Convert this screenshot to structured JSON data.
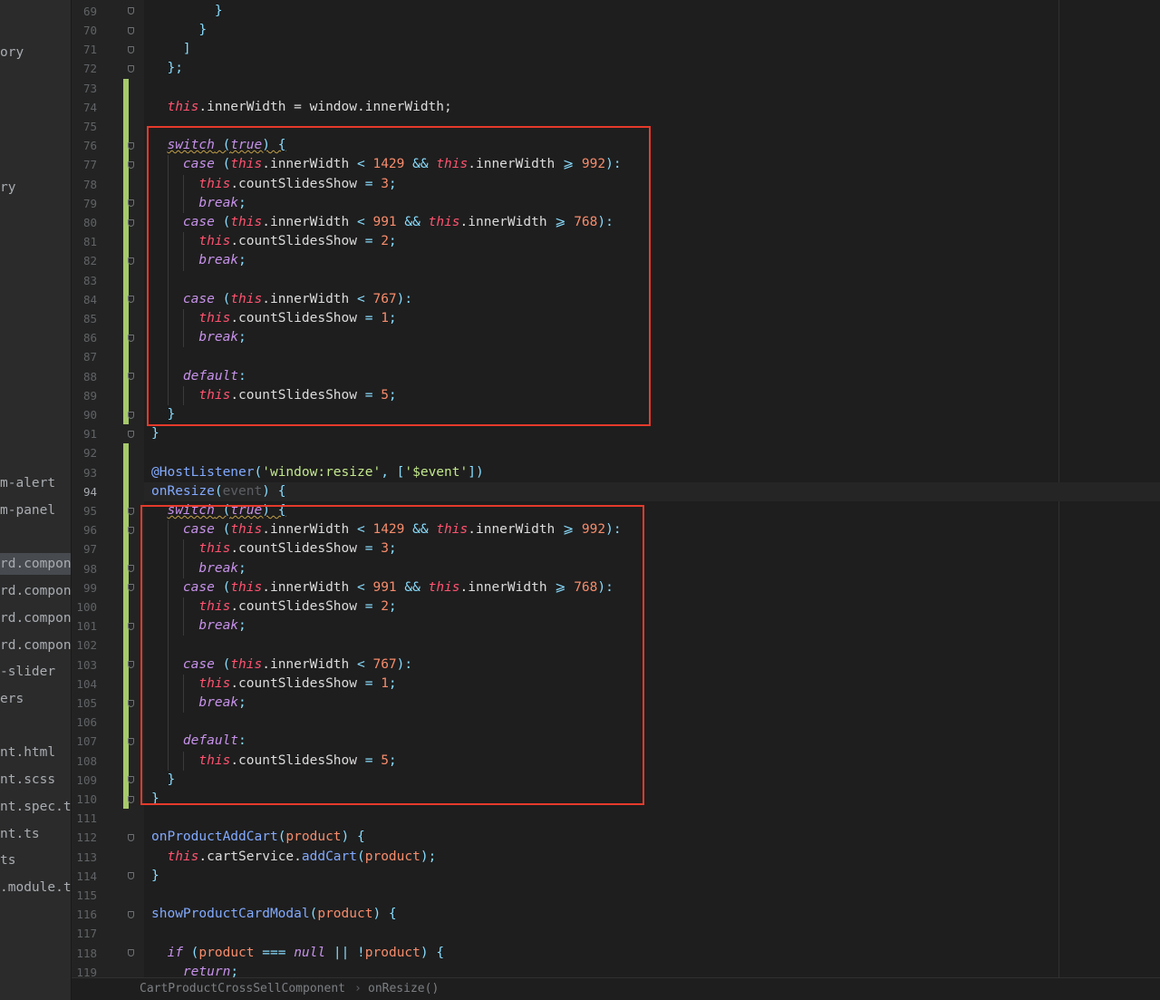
{
  "sidebar": {
    "items": [
      {
        "label": "ory",
        "selected": false
      },
      {
        "label": "ry",
        "selected": false
      },
      {
        "label": "m-alert",
        "selected": false
      },
      {
        "label": "m-panel",
        "selected": false
      },
      {
        "label": "rd.compone",
        "selected": true
      },
      {
        "label": "rd.compone",
        "selected": false
      },
      {
        "label": "rd.compone",
        "selected": false
      },
      {
        "label": "rd.compone",
        "selected": false
      },
      {
        "label": "-slider",
        "selected": false
      },
      {
        "label": "ers",
        "selected": false
      },
      {
        "label": "nt.html",
        "selected": false
      },
      {
        "label": "nt.scss",
        "selected": false
      },
      {
        "label": "nt.spec.t",
        "selected": false
      },
      {
        "label": "nt.ts",
        "selected": false
      },
      {
        "label": "ts",
        "selected": false
      },
      {
        "label": ".module.t",
        "selected": false
      }
    ]
  },
  "editor": {
    "current_line": 94,
    "lines": [
      {
        "n": 69,
        "code": [
          [
            "        }",
            "op"
          ]
        ]
      },
      {
        "n": 70,
        "code": [
          [
            "      }",
            "op"
          ]
        ]
      },
      {
        "n": 71,
        "code": [
          [
            "    ]",
            "op"
          ]
        ]
      },
      {
        "n": 72,
        "code": [
          [
            "  };",
            "op"
          ]
        ]
      },
      {
        "n": 73,
        "code": []
      },
      {
        "n": 74,
        "code": [
          [
            "  ",
            "id"
          ],
          [
            "this",
            "th"
          ],
          [
            ".innerWidth = window.innerWidth;",
            "id"
          ]
        ]
      },
      {
        "n": 75,
        "code": []
      },
      {
        "n": 76,
        "code": [
          [
            "  ",
            "id"
          ],
          [
            "switch",
            "kw wavy"
          ],
          [
            " (",
            "op wavy"
          ],
          [
            "true",
            "kw wavy"
          ],
          [
            ") {",
            "op wavy"
          ]
        ]
      },
      {
        "n": 77,
        "code": [
          [
            "    ",
            "id"
          ],
          [
            "case",
            "kw"
          ],
          [
            " (",
            "op"
          ],
          [
            "this",
            "th"
          ],
          [
            ".innerWidth ",
            "id"
          ],
          [
            "<",
            "op"
          ],
          [
            " ",
            "id"
          ],
          [
            "1429",
            "num"
          ],
          [
            " ",
            "id"
          ],
          [
            "&&",
            "op"
          ],
          [
            " ",
            "id"
          ],
          [
            "this",
            "th"
          ],
          [
            ".innerWidth ",
            "id"
          ],
          [
            "⩾",
            "op"
          ],
          [
            " ",
            "id"
          ],
          [
            "992",
            "num"
          ],
          [
            "):",
            "op"
          ]
        ]
      },
      {
        "n": 78,
        "code": [
          [
            "      ",
            "id"
          ],
          [
            "this",
            "th"
          ],
          [
            ".countSlidesShow ",
            "id"
          ],
          [
            "=",
            "op"
          ],
          [
            " ",
            "id"
          ],
          [
            "3",
            "num"
          ],
          [
            ";",
            "op"
          ]
        ]
      },
      {
        "n": 79,
        "code": [
          [
            "      ",
            "id"
          ],
          [
            "break",
            "kw"
          ],
          [
            ";",
            "op"
          ]
        ]
      },
      {
        "n": 80,
        "code": [
          [
            "    ",
            "id"
          ],
          [
            "case",
            "kw"
          ],
          [
            " (",
            "op"
          ],
          [
            "this",
            "th"
          ],
          [
            ".innerWidth ",
            "id"
          ],
          [
            "<",
            "op"
          ],
          [
            " ",
            "id"
          ],
          [
            "991",
            "num"
          ],
          [
            " ",
            "id"
          ],
          [
            "&&",
            "op"
          ],
          [
            " ",
            "id"
          ],
          [
            "this",
            "th"
          ],
          [
            ".innerWidth ",
            "id"
          ],
          [
            "⩾",
            "op"
          ],
          [
            " ",
            "id"
          ],
          [
            "768",
            "num"
          ],
          [
            "):",
            "op"
          ]
        ]
      },
      {
        "n": 81,
        "code": [
          [
            "      ",
            "id"
          ],
          [
            "this",
            "th"
          ],
          [
            ".countSlidesShow ",
            "id"
          ],
          [
            "=",
            "op"
          ],
          [
            " ",
            "id"
          ],
          [
            "2",
            "num"
          ],
          [
            ";",
            "op"
          ]
        ]
      },
      {
        "n": 82,
        "code": [
          [
            "      ",
            "id"
          ],
          [
            "break",
            "kw"
          ],
          [
            ";",
            "op"
          ]
        ]
      },
      {
        "n": 83,
        "code": []
      },
      {
        "n": 84,
        "code": [
          [
            "    ",
            "id"
          ],
          [
            "case",
            "kw"
          ],
          [
            " (",
            "op"
          ],
          [
            "this",
            "th"
          ],
          [
            ".innerWidth ",
            "id"
          ],
          [
            "<",
            "op"
          ],
          [
            " ",
            "id"
          ],
          [
            "767",
            "num"
          ],
          [
            "):",
            "op"
          ]
        ]
      },
      {
        "n": 85,
        "code": [
          [
            "      ",
            "id"
          ],
          [
            "this",
            "th"
          ],
          [
            ".countSlidesShow ",
            "id"
          ],
          [
            "=",
            "op"
          ],
          [
            " ",
            "id"
          ],
          [
            "1",
            "num"
          ],
          [
            ";",
            "op"
          ]
        ]
      },
      {
        "n": 86,
        "code": [
          [
            "      ",
            "id"
          ],
          [
            "break",
            "kw"
          ],
          [
            ";",
            "op"
          ]
        ]
      },
      {
        "n": 87,
        "code": []
      },
      {
        "n": 88,
        "code": [
          [
            "    ",
            "id"
          ],
          [
            "default",
            "kw"
          ],
          [
            ":",
            "op"
          ]
        ]
      },
      {
        "n": 89,
        "code": [
          [
            "      ",
            "id"
          ],
          [
            "this",
            "th"
          ],
          [
            ".countSlidesShow ",
            "id"
          ],
          [
            "=",
            "op"
          ],
          [
            " ",
            "id"
          ],
          [
            "5",
            "num"
          ],
          [
            ";",
            "op"
          ]
        ]
      },
      {
        "n": 90,
        "code": [
          [
            "  }",
            "op"
          ]
        ]
      },
      {
        "n": 91,
        "code": [
          [
            "}",
            "op"
          ]
        ]
      },
      {
        "n": 92,
        "code": []
      },
      {
        "n": 93,
        "code": [
          [
            "@HostListener",
            "dec"
          ],
          [
            "(",
            "op"
          ],
          [
            "'window:resize'",
            "str"
          ],
          [
            ", [",
            "op"
          ],
          [
            "'$event'",
            "str"
          ],
          [
            "])",
            "op"
          ]
        ]
      },
      {
        "n": 94,
        "code": [
          [
            "onResize",
            "fn"
          ],
          [
            "(",
            "op"
          ],
          [
            "event",
            "dim"
          ],
          [
            ") {",
            "op"
          ]
        ]
      },
      {
        "n": 95,
        "code": [
          [
            "  ",
            "id"
          ],
          [
            "switch",
            "kw wavy"
          ],
          [
            " (",
            "op wavy"
          ],
          [
            "true",
            "kw wavy"
          ],
          [
            ") {",
            "op wavy"
          ]
        ]
      },
      {
        "n": 96,
        "code": [
          [
            "    ",
            "id"
          ],
          [
            "case",
            "kw"
          ],
          [
            " (",
            "op"
          ],
          [
            "this",
            "th"
          ],
          [
            ".innerWidth ",
            "id"
          ],
          [
            "<",
            "op"
          ],
          [
            " ",
            "id"
          ],
          [
            "1429",
            "num"
          ],
          [
            " ",
            "id"
          ],
          [
            "&&",
            "op"
          ],
          [
            " ",
            "id"
          ],
          [
            "this",
            "th"
          ],
          [
            ".innerWidth ",
            "id"
          ],
          [
            "⩾",
            "op"
          ],
          [
            " ",
            "id"
          ],
          [
            "992",
            "num"
          ],
          [
            "):",
            "op"
          ]
        ]
      },
      {
        "n": 97,
        "code": [
          [
            "      ",
            "id"
          ],
          [
            "this",
            "th"
          ],
          [
            ".countSlidesShow ",
            "id"
          ],
          [
            "=",
            "op"
          ],
          [
            " ",
            "id"
          ],
          [
            "3",
            "num"
          ],
          [
            ";",
            "op"
          ]
        ]
      },
      {
        "n": 98,
        "code": [
          [
            "      ",
            "id"
          ],
          [
            "break",
            "kw"
          ],
          [
            ";",
            "op"
          ]
        ]
      },
      {
        "n": 99,
        "code": [
          [
            "    ",
            "id"
          ],
          [
            "case",
            "kw"
          ],
          [
            " (",
            "op"
          ],
          [
            "this",
            "th"
          ],
          [
            ".innerWidth ",
            "id"
          ],
          [
            "<",
            "op"
          ],
          [
            " ",
            "id"
          ],
          [
            "991",
            "num"
          ],
          [
            " ",
            "id"
          ],
          [
            "&&",
            "op"
          ],
          [
            " ",
            "id"
          ],
          [
            "this",
            "th"
          ],
          [
            ".innerWidth ",
            "id"
          ],
          [
            "⩾",
            "op"
          ],
          [
            " ",
            "id"
          ],
          [
            "768",
            "num"
          ],
          [
            "):",
            "op"
          ]
        ]
      },
      {
        "n": 100,
        "code": [
          [
            "      ",
            "id"
          ],
          [
            "this",
            "th"
          ],
          [
            ".countSlidesShow ",
            "id"
          ],
          [
            "=",
            "op"
          ],
          [
            " ",
            "id"
          ],
          [
            "2",
            "num"
          ],
          [
            ";",
            "op"
          ]
        ]
      },
      {
        "n": 101,
        "code": [
          [
            "      ",
            "id"
          ],
          [
            "break",
            "kw"
          ],
          [
            ";",
            "op"
          ]
        ]
      },
      {
        "n": 102,
        "code": []
      },
      {
        "n": 103,
        "code": [
          [
            "    ",
            "id"
          ],
          [
            "case",
            "kw"
          ],
          [
            " (",
            "op"
          ],
          [
            "this",
            "th"
          ],
          [
            ".innerWidth ",
            "id"
          ],
          [
            "<",
            "op"
          ],
          [
            " ",
            "id"
          ],
          [
            "767",
            "num"
          ],
          [
            "):",
            "op"
          ]
        ]
      },
      {
        "n": 104,
        "code": [
          [
            "      ",
            "id"
          ],
          [
            "this",
            "th"
          ],
          [
            ".countSlidesShow ",
            "id"
          ],
          [
            "=",
            "op"
          ],
          [
            " ",
            "id"
          ],
          [
            "1",
            "num"
          ],
          [
            ";",
            "op"
          ]
        ]
      },
      {
        "n": 105,
        "code": [
          [
            "      ",
            "id"
          ],
          [
            "break",
            "kw"
          ],
          [
            ";",
            "op"
          ]
        ]
      },
      {
        "n": 106,
        "code": []
      },
      {
        "n": 107,
        "code": [
          [
            "    ",
            "id"
          ],
          [
            "default",
            "kw"
          ],
          [
            ":",
            "op"
          ]
        ]
      },
      {
        "n": 108,
        "code": [
          [
            "      ",
            "id"
          ],
          [
            "this",
            "th"
          ],
          [
            ".countSlidesShow ",
            "id"
          ],
          [
            "=",
            "op"
          ],
          [
            " ",
            "id"
          ],
          [
            "5",
            "num"
          ],
          [
            ";",
            "op"
          ]
        ]
      },
      {
        "n": 109,
        "code": [
          [
            "  }",
            "op"
          ]
        ]
      },
      {
        "n": 110,
        "code": [
          [
            "}",
            "op"
          ]
        ]
      },
      {
        "n": 111,
        "code": []
      },
      {
        "n": 112,
        "code": [
          [
            "onProductAddCart",
            "fn"
          ],
          [
            "(",
            "op"
          ],
          [
            "product",
            "param"
          ],
          [
            ") {",
            "op"
          ]
        ]
      },
      {
        "n": 113,
        "code": [
          [
            "  ",
            "id"
          ],
          [
            "this",
            "th"
          ],
          [
            ".cartService.",
            "id"
          ],
          [
            "addCart",
            "fn"
          ],
          [
            "(",
            "op"
          ],
          [
            "product",
            "param"
          ],
          [
            ");",
            "op"
          ]
        ]
      },
      {
        "n": 114,
        "code": [
          [
            "}",
            "op"
          ]
        ]
      },
      {
        "n": 115,
        "code": []
      },
      {
        "n": 116,
        "code": [
          [
            "showProductCardModal",
            "fn"
          ],
          [
            "(",
            "op"
          ],
          [
            "product",
            "param"
          ],
          [
            ") {",
            "op"
          ]
        ]
      },
      {
        "n": 117,
        "code": []
      },
      {
        "n": 118,
        "code": [
          [
            "  ",
            "id"
          ],
          [
            "if",
            "kw"
          ],
          [
            " (",
            "op"
          ],
          [
            "product",
            "param"
          ],
          [
            " ",
            "id"
          ],
          [
            "===",
            "op"
          ],
          [
            " ",
            "id"
          ],
          [
            "null",
            "kw"
          ],
          [
            " ",
            "id"
          ],
          [
            "||",
            "op"
          ],
          [
            " ",
            "id"
          ],
          [
            "!",
            "op"
          ],
          [
            "product",
            "param"
          ],
          [
            ") {",
            "op"
          ]
        ]
      },
      {
        "n": 119,
        "code": [
          [
            "    ",
            "id"
          ],
          [
            "return",
            "kw"
          ],
          [
            ";",
            "op"
          ]
        ]
      }
    ]
  },
  "breadcrumb": {
    "items": [
      "CartProductCrossSellComponent",
      "onResize()"
    ],
    "separator": "›"
  },
  "colors": {
    "highlight_box": "#e63a2b",
    "vcs_added": "#a6c96b"
  }
}
